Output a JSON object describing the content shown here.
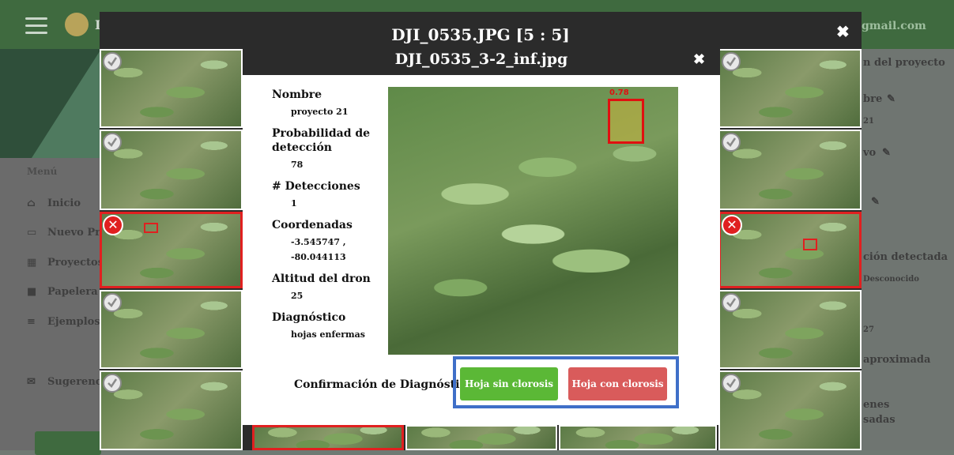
{
  "app": {
    "user_email": "@gmail.com",
    "logo_letter": "I",
    "menu_title": "Menú",
    "sidebar_items": [
      {
        "label": "Inicio",
        "icon": "home-icon"
      },
      {
        "label": "Nuevo Pro",
        "icon": "new-project-icon"
      },
      {
        "label": "Proyectos",
        "icon": "projects-icon"
      },
      {
        "label": "Papelera",
        "icon": "trash-icon"
      },
      {
        "label": "Ejemplos",
        "icon": "list-icon"
      },
      {
        "label": "Sugerencia",
        "icon": "mail-icon"
      }
    ],
    "right_panel": {
      "section_title": "n del proyecto",
      "nombre": "bre",
      "nombre_value": "21",
      "tipo": "vo",
      "detection": "ción detectada",
      "detection_value": "Desconocido",
      "num": "27",
      "approx": "aproximada",
      "images": "enes",
      "images2": "sadas"
    }
  },
  "outer_modal": {
    "title": "DJI_0535.JPG [5 : 5]",
    "close": "✖"
  },
  "inner_modal": {
    "title": "DJI_0535_3-2_inf.jpg",
    "close": "✖",
    "fields": {
      "nombre_label": "Nombre",
      "nombre_value": "proyecto 21",
      "prob_label": "Probabilidad de detección",
      "prob_value": "78",
      "detections_label": "# Detecciones",
      "detections_value": "1",
      "coords_label": "Coordenadas",
      "lat_value": "-3.545747 ,",
      "lon_value": "-80.044113",
      "altitude_label": "Altitud del dron",
      "altitude_value": "25",
      "diagnosis_label": "Diagnóstico",
      "diagnosis_value": "hojas enfermas"
    },
    "detection_label": "0.78",
    "confirm_label": "Confirmación de Diagnóstico:",
    "btn_no_chlorosis": "Hoja sin clorosis",
    "btn_chlorosis": "Hoja con clorosis",
    "colors": {
      "green": "#5bb836",
      "red": "#d95b5b",
      "highlight": "#3f6fc8"
    }
  }
}
